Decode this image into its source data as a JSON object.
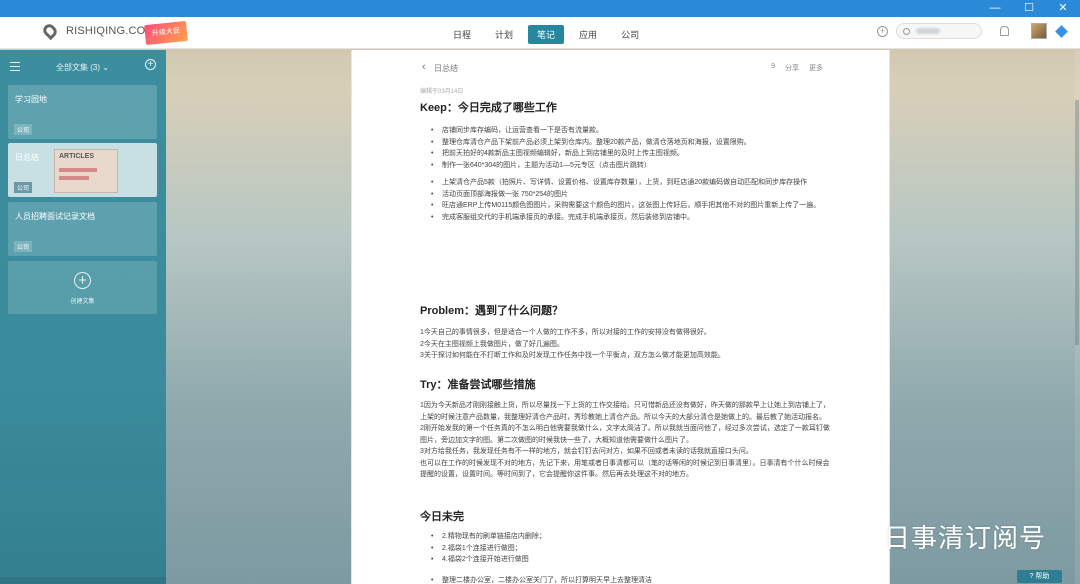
{
  "window": {
    "min": "—",
    "max": "☐",
    "close": "✕"
  },
  "header": {
    "logo_text": "RISHIQING.COM",
    "promo_text": "升级大促",
    "tabs": [
      {
        "label": "日程"
      },
      {
        "label": "计划"
      },
      {
        "label": "笔记"
      },
      {
        "label": "应用"
      },
      {
        "label": "公司"
      }
    ],
    "active_tab": "笔记"
  },
  "sidebar": {
    "folder_label": "全部文集 (3)",
    "notes": [
      {
        "title": "学习园地",
        "tag": "公司"
      },
      {
        "title": "日总结",
        "tag": "公司",
        "thumb": "ARTICLES"
      },
      {
        "title": "人员招聘面试记录文档",
        "tag": "公司"
      }
    ],
    "new_label": "创建文集"
  },
  "doc": {
    "back_label": "日总结",
    "actions": {
      "count": "9",
      "share": "分享",
      "more": "更多"
    },
    "meta": "编辑于03月14日",
    "sections": {
      "keep": {
        "heading": "Keep：今日完成了哪些工作",
        "items": [
          "店铺同步库存编码，让运营查看一下是否有流量款。",
          "整理仓库清仓产品下架前产品必须上架到仓库内。整理20款产品，做清仓落地页和海报，设置限购。",
          "把前天拍好的4款新品主图视频编辑好，新品上到店铺里的及时上传主图视频。",
          "制作一张640*304的图片，主题为活动1—5元专区（点击图片跳转）",
          "上架清仓产品5款（拍照片、写详情、设置价格、设置库存数量），上货，到旺店通20款编码做自动匹配和同步库存操作",
          "活动页面顶部海报做一张 750*254的图片",
          "旺店通ERP上传M0115颜色图图片，采购需要这个颜色的图片，这张图上传好后，顺手把其他不对的图片重新上传了一遍。",
          "完成客服组交代的手机端承接页的承接。完成手机端承接页，然后装修到店铺中。"
        ]
      },
      "problem": {
        "heading": "Problem：遇到了什么问题？",
        "lines": [
          "1今天自己的事情很多，但是适合一个人做的工作不多，所以对接的工作的安排没有做得很好。",
          "2今天在主图视频上我做图片，做了好几遍图。",
          "3关于探讨如何能在不打断工作和及时发现工作任务中找一个平衡点，双方怎么做才能更加高效能。"
        ]
      },
      "try": {
        "heading": "Try：准备尝试哪些措施",
        "lines": [
          "1因为今天新品才刚刚接触上货，所以尽量找一下上货的工作交接给。只可惜新品还没有做好，昨天做的那款早上让她上到店铺上了，上架的时候注意产品数量，我整理好清仓产品时，秀珍教她上清仓产品。所以今天的大部分清仓是她做上的。最后教了她活动报名。",
          "2刚开始发我的第一个任务真的不怎么明白他需要我做什么，文字太简洁了。所以我就当面问他了，经过多次尝试，选定了一款耳钉做图片，旁边加文字的图。第二次做图的时候我快一些了，大概知道他需要做什么图片了。",
          "3对方给我任务，我发现任务有不一样的地方，就会钉钉去问对方，如果不回或者未读的话我就直接口头问。",
          "也可以在工作的时候发现不对的地方，先记下来，用笔或者日事清都可以（笔的话等闲的时候记到日事清里）。日事清有个什么时候会提醒的设置，设置时间。等时间到了，它会提醒你这件事。然后再去处理这不对的地方。"
        ]
      },
      "unfinished": {
        "heading": "今日未完",
        "items": [
          "2.精物现有的刷单链接店内删除；",
          "2.福袋1个连接进行做图；",
          "4.福袋2个连接开始进行做图"
        ],
        "tail": "整理二楼办公室，二楼办公室关门了，所以打算明天早上去整理清洁"
      }
    }
  },
  "watermark": "日事清订阅号",
  "help_label": "帮助"
}
